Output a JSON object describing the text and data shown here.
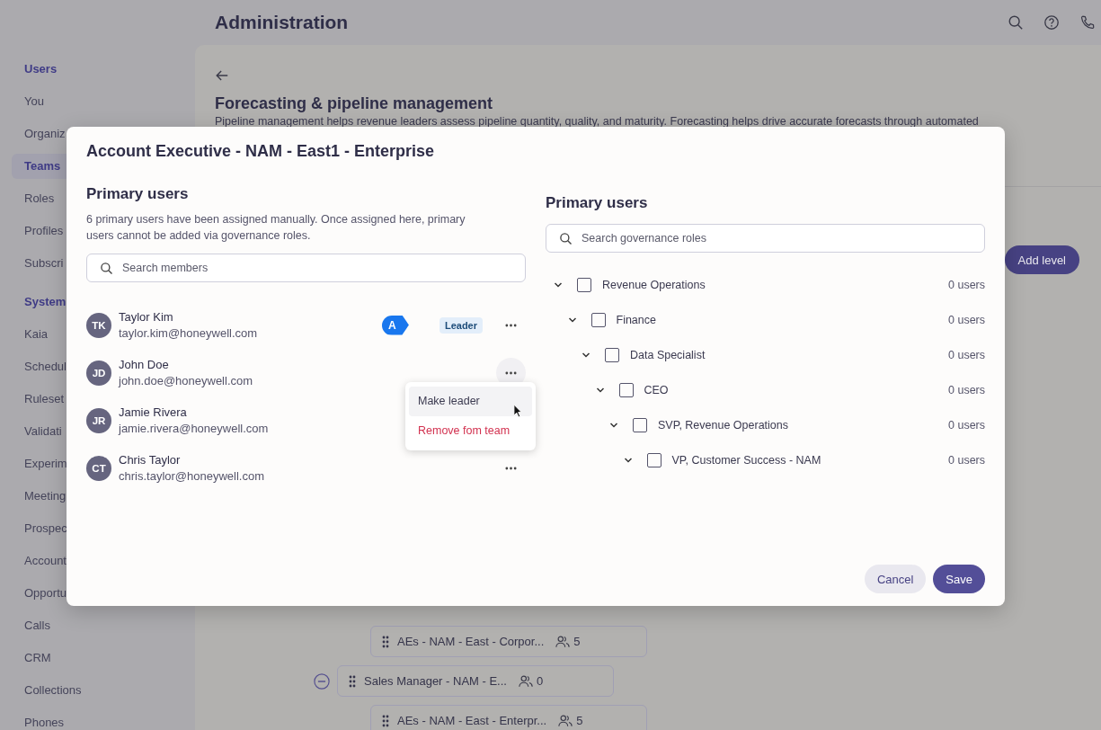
{
  "header": {
    "title": "Administration"
  },
  "sidebar": {
    "groups": [
      {
        "heading": "Users",
        "items": [
          {
            "label": "You",
            "selected": false
          },
          {
            "label": "Organiz",
            "selected": false
          },
          {
            "label": "Teams",
            "selected": true
          },
          {
            "label": "Roles",
            "selected": false
          },
          {
            "label": "Profiles",
            "selected": false
          },
          {
            "label": "Subscri",
            "selected": false
          }
        ]
      },
      {
        "heading": "System",
        "items": [
          {
            "label": "Kaia",
            "selected": false
          },
          {
            "label": "Schedul",
            "selected": false
          },
          {
            "label": "Ruleset",
            "selected": false
          },
          {
            "label": "Validati",
            "selected": false
          },
          {
            "label": "Experim",
            "selected": false
          },
          {
            "label": "Meeting",
            "selected": false
          },
          {
            "label": "Prospec",
            "selected": false
          },
          {
            "label": "Account",
            "selected": false
          },
          {
            "label": "Opportu",
            "selected": false
          },
          {
            "label": "Calls",
            "selected": false
          },
          {
            "label": "CRM",
            "selected": false
          },
          {
            "label": "Collections",
            "selected": false
          },
          {
            "label": "Phones",
            "selected": false
          }
        ]
      }
    ]
  },
  "page": {
    "title": "Forecasting & pipeline management",
    "description": "Pipeline management helps revenue leaders assess pipeline quantity, quality, and maturity. Forecasting helps drive accurate forecasts through automated",
    "add_button": "Add level",
    "team_nodes": [
      {
        "kind": "child",
        "label": "AEs - NAM - East - Corpor...",
        "count": "5"
      },
      {
        "kind": "parent",
        "label": "Sales Manager - NAM - E...",
        "count": "0"
      },
      {
        "kind": "child",
        "label": "AEs - NAM - East - Enterpr...",
        "count": "5"
      }
    ]
  },
  "dialog": {
    "title": "Account Executive - NAM - East1 - Enterprise",
    "left": {
      "heading": "Primary users",
      "note": "6 primary users have been assigned manually. Once assigned here, primary users cannot be added via governance roles.",
      "search": {
        "placeholder": "Search members"
      },
      "members": [
        {
          "initials": "TK",
          "name": "Taylor Kim",
          "email": "taylor.kim@honeywell.com",
          "badge": "Leader",
          "marker": "A",
          "menu_open": false
        },
        {
          "initials": "JD",
          "name": "John Doe",
          "email": "john.doe@honeywell.com",
          "menu_open": true
        },
        {
          "initials": "JR",
          "name": "Jamie Rivera",
          "email": "jamie.rivera@honeywell.com",
          "menu_open": false
        },
        {
          "initials": "CT",
          "name": "Chris Taylor",
          "email": "chris.taylor@honeywell.com",
          "menu_open": false
        }
      ],
      "menu": [
        {
          "label": "Make leader",
          "kind": "normal",
          "selected": true
        },
        {
          "label": "Remove fom team",
          "kind": "danger",
          "selected": false
        }
      ]
    },
    "right": {
      "heading": "Primary users",
      "search": {
        "placeholder": "Search governance roles"
      },
      "roles": [
        {
          "label": "Revenue Operations",
          "count": "0 users",
          "expanded": true,
          "checked": false,
          "children": [
            {
              "label": "Finance",
              "count": "0 users",
              "expanded": true,
              "checked": false,
              "children": [
                {
                  "label": "Data Specialist",
                  "count": "0 users",
                  "expanded": true,
                  "checked": false,
                  "children": [
                    {
                      "label": "CEO",
                      "count": "0 users",
                      "expanded": true,
                      "checked": false,
                      "children": [
                        {
                          "label": "SVP, Revenue Operations",
                          "count": "0 users",
                          "expanded": true,
                          "checked": false,
                          "children": [
                            {
                              "label": "VP, Customer Success - NAM",
                              "count": "0 users",
                              "expanded": true,
                              "checked": false
                            }
                          ]
                        }
                      ]
                    }
                  ]
                }
              ]
            }
          ]
        }
      ]
    },
    "buttons": [
      {
        "label": "Cancel",
        "kind": "secondary"
      },
      {
        "label": "Save",
        "kind": "primary"
      }
    ]
  }
}
